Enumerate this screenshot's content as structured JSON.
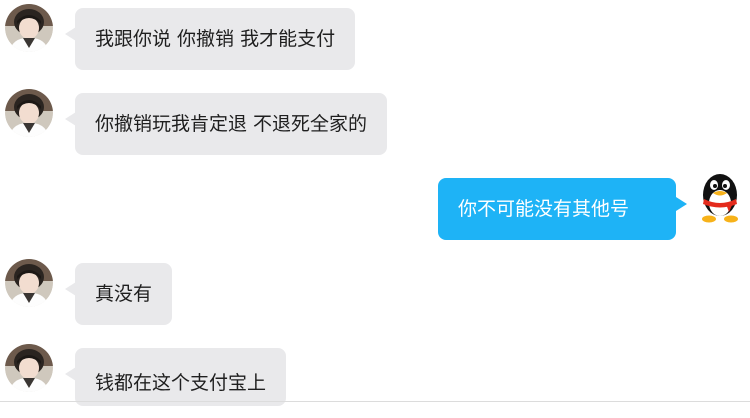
{
  "messages": [
    {
      "side": "left",
      "text": "我跟你说 你撤销 我才能支付",
      "avatar": "user-avatar"
    },
    {
      "side": "left",
      "text": "你撤销玩我肯定退 不退死全家的",
      "avatar": "user-avatar"
    },
    {
      "side": "right",
      "text": "你不可能没有其他号",
      "avatar": "qq-penguin-avatar"
    },
    {
      "side": "left",
      "text": "真没有",
      "avatar": "user-avatar"
    },
    {
      "side": "left",
      "text": "钱都在这个支付宝上",
      "avatar": "user-avatar"
    }
  ],
  "colors": {
    "incoming_bubble": "#e9e9eb",
    "outgoing_bubble": "#1eb3f6",
    "incoming_text": "#1f1f1f",
    "outgoing_text": "#ffffff"
  }
}
